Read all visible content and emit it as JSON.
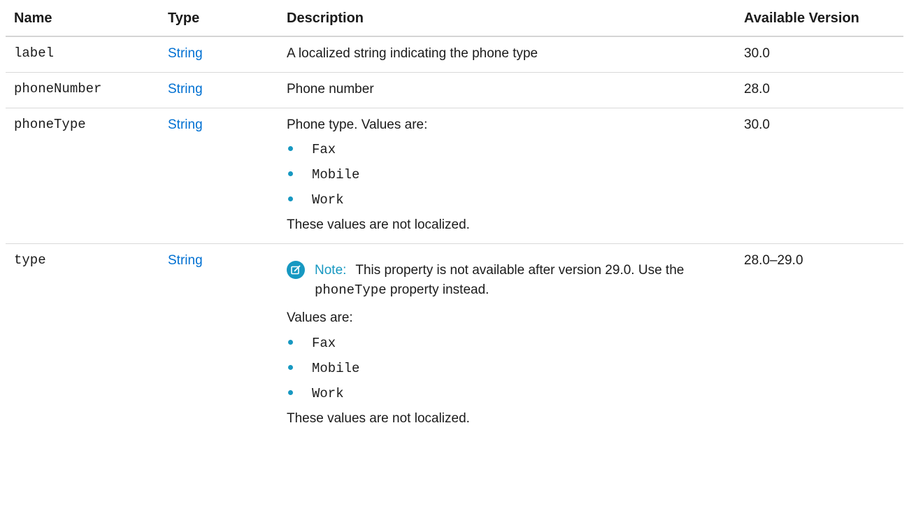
{
  "table": {
    "headers": {
      "name": "Name",
      "type": "Type",
      "description": "Description",
      "version": "Available Version"
    },
    "rows": [
      {
        "name": "label",
        "type": "String",
        "description": "A localized string indicating the phone type",
        "version": "30.0"
      },
      {
        "name": "phoneNumber",
        "type": "String",
        "description": "Phone number",
        "version": "28.0"
      },
      {
        "name": "phoneType",
        "type": "String",
        "description_intro": "Phone type. Values are:",
        "values": [
          "Fax",
          "Mobile",
          "Work"
        ],
        "description_outro": "These values are not localized.",
        "version": "30.0"
      },
      {
        "name": "type",
        "type": "String",
        "note": {
          "icon": "edit-note-icon",
          "label": "Note:",
          "text_before": "This property is not available after version 29.0. Use the",
          "code": "phoneType",
          "text_after": "property instead."
        },
        "description_intro": "Values are:",
        "values": [
          "Fax",
          "Mobile",
          "Work"
        ],
        "description_outro": "These values are not localized.",
        "version": "28.0–29.0"
      }
    ]
  },
  "colors": {
    "link": "#0070d2",
    "accent": "#1798c1",
    "text": "#1b1b1b"
  }
}
